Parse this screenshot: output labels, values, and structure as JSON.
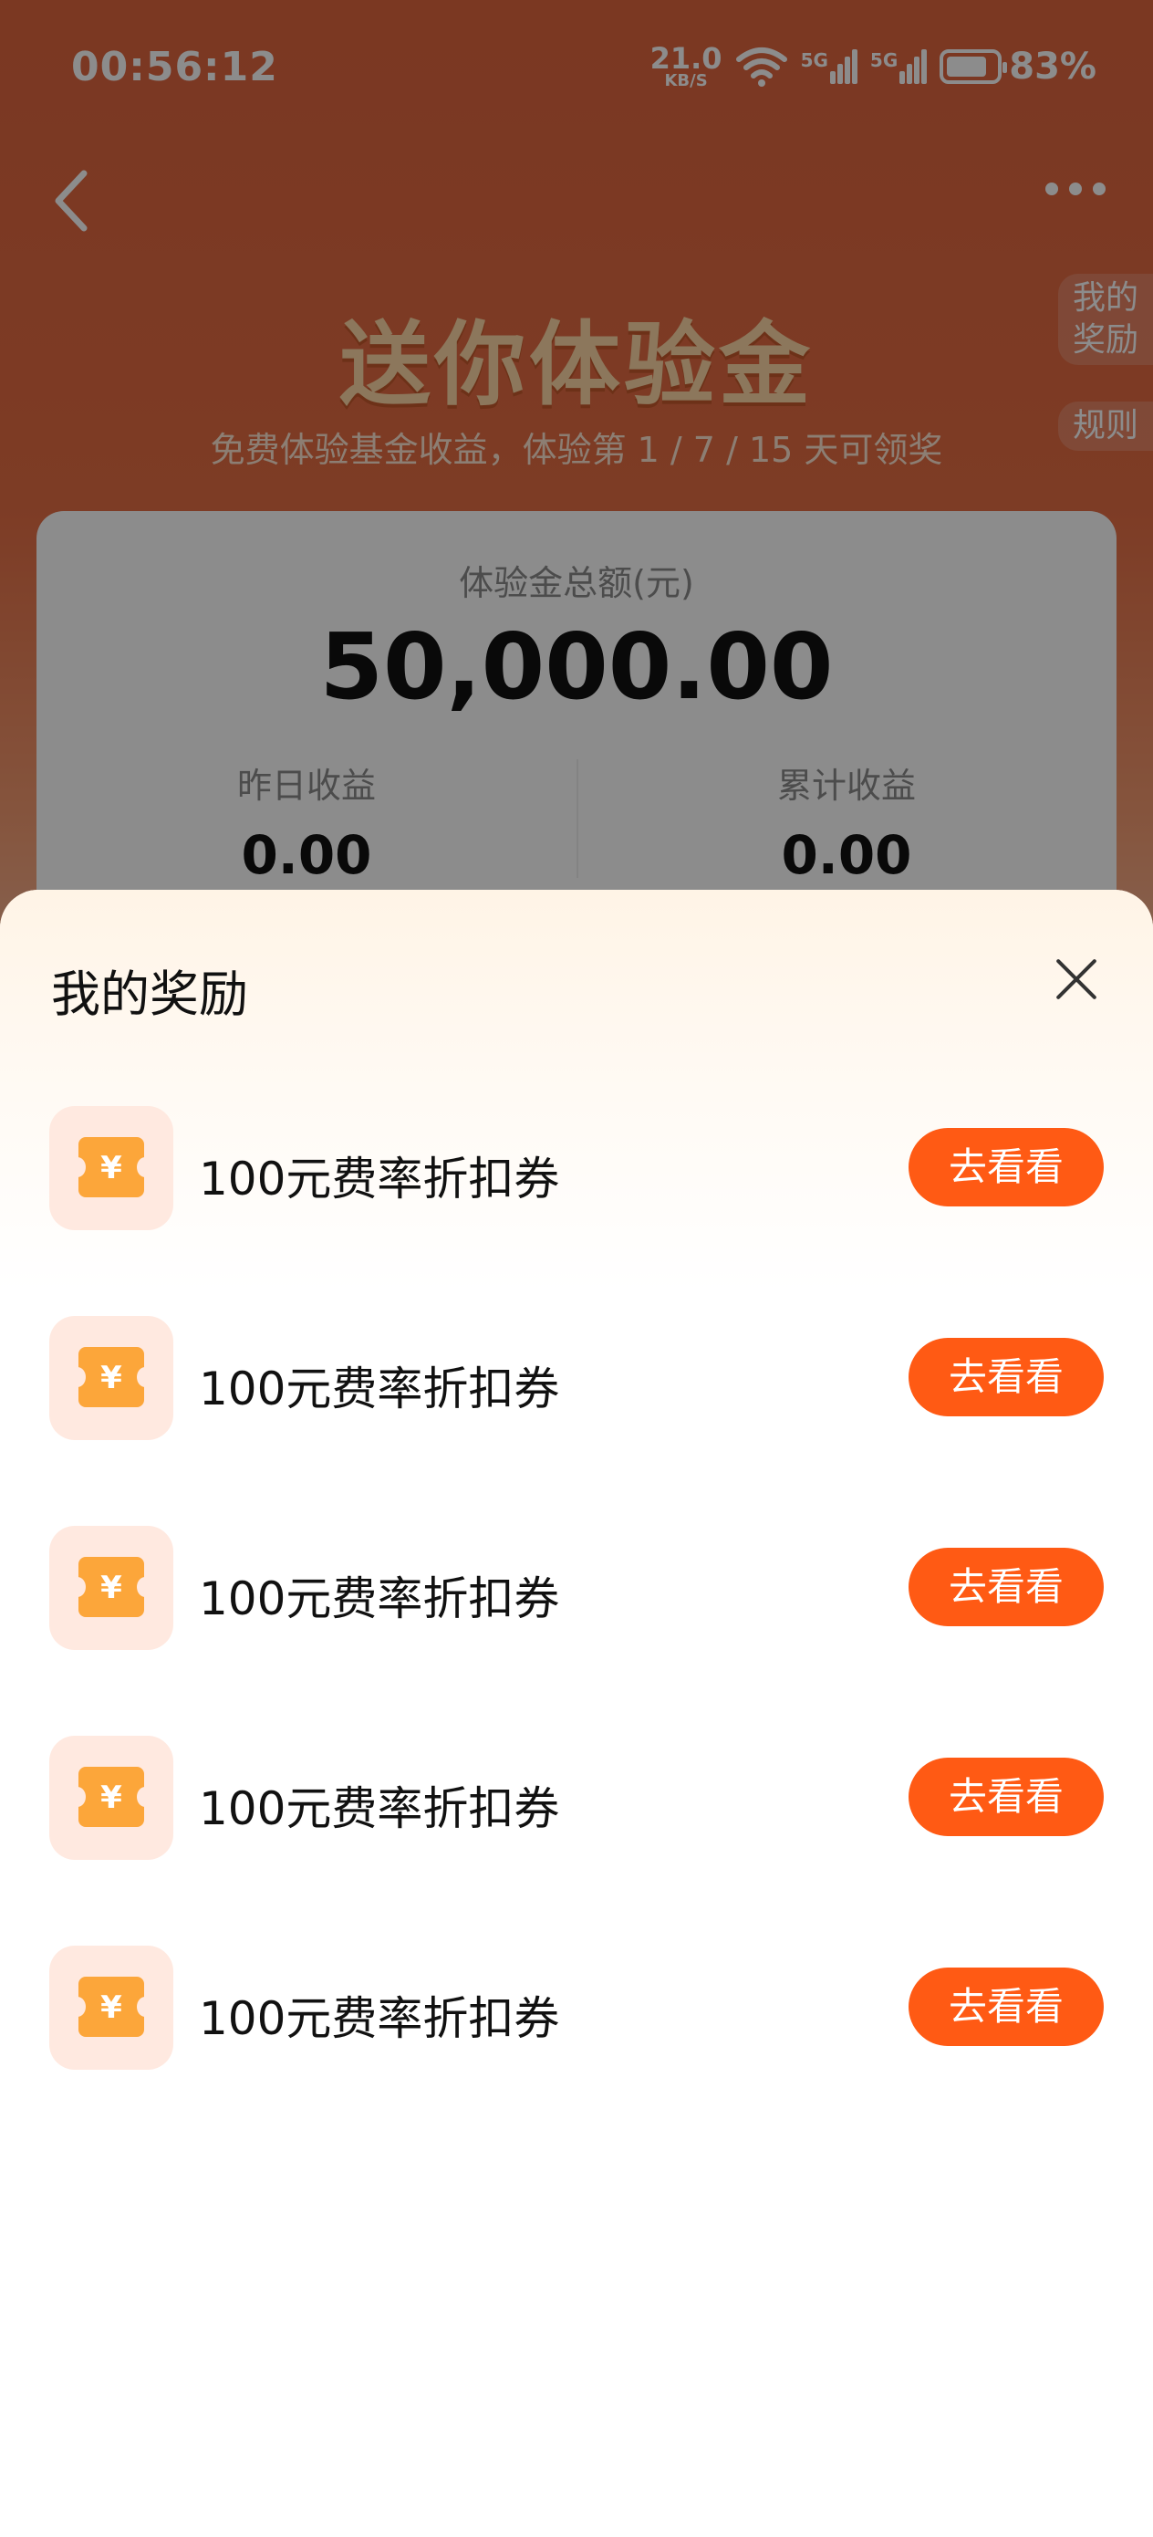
{
  "status_bar": {
    "time": "00:56:12",
    "net_speed_value": "21.0",
    "net_speed_unit": "KB/S",
    "signal_1": "5G",
    "signal_2": "5G",
    "battery": "83%"
  },
  "header": {
    "title": "送你体验金",
    "subtitle": "免费体验基金收益，体验第 1 / 7 / 15 天可领奖",
    "side_tab_rewards": "我的\n奖励",
    "side_tab_rules": "规则"
  },
  "summary_card": {
    "total_label": "体验金总额(元)",
    "total_value": "50,000.00",
    "yesterday_label": "昨日收益",
    "yesterday_value": "0.00",
    "cumulative_label": "累计收益",
    "cumulative_value": "0.00"
  },
  "sheet": {
    "title": "我的奖励",
    "items": [
      {
        "icon": "coupon-icon",
        "symbol": "¥",
        "label": "100元费率折扣券",
        "button": "去看看"
      },
      {
        "icon": "coupon-icon",
        "symbol": "¥",
        "label": "100元费率折扣券",
        "button": "去看看"
      },
      {
        "icon": "coupon-icon",
        "symbol": "¥",
        "label": "100元费率折扣券",
        "button": "去看看"
      },
      {
        "icon": "coupon-icon",
        "symbol": "¥",
        "label": "100元费率折扣券",
        "button": "去看看"
      },
      {
        "icon": "coupon-icon",
        "symbol": "¥",
        "label": "100元费率折扣券",
        "button": "去看看"
      }
    ]
  },
  "colors": {
    "accent_button": "#ff5a14",
    "coupon_icon": "#fca63a",
    "header_bg": "#e0663f"
  }
}
